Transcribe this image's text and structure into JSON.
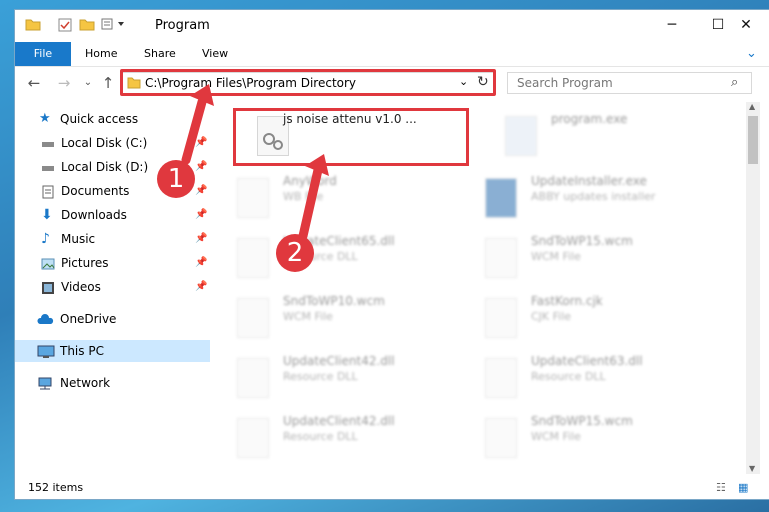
{
  "window": {
    "title": "Program"
  },
  "ribbon": {
    "tabs": [
      "File",
      "Home",
      "Share",
      "View"
    ]
  },
  "address": {
    "path": "C:\\Program Files\\Program Directory"
  },
  "search": {
    "placeholder": "Search Program"
  },
  "nav": {
    "items": [
      {
        "label": "Quick access",
        "icon": "star-icon"
      },
      {
        "label": "Local Disk (C:)",
        "icon": "drive-icon"
      },
      {
        "label": "Local Disk (D:)",
        "icon": "drive-icon"
      },
      {
        "label": "Documents",
        "icon": "documents-icon"
      },
      {
        "label": "Downloads",
        "icon": "download-icon"
      },
      {
        "label": "Music",
        "icon": "music-icon"
      },
      {
        "label": "Pictures",
        "icon": "pictures-icon"
      },
      {
        "label": "Videos",
        "icon": "videos-icon"
      },
      {
        "label": "OneDrive",
        "icon": "cloud-icon"
      },
      {
        "label": "This PC",
        "icon": "computer-icon"
      },
      {
        "label": "Network",
        "icon": "network-icon"
      }
    ]
  },
  "files": [
    {
      "name": "js noise attenu v1.0 ...",
      "type": ""
    },
    {
      "name": "program.exe",
      "type": ""
    },
    {
      "name": "AnyWord",
      "type": "WB File"
    },
    {
      "name": "UpdateInstaller.exe",
      "type": "ABBY updates installer"
    },
    {
      "name": "UpdateClient65.dll",
      "type": "Resource DLL"
    },
    {
      "name": "SndToWP15.wcm",
      "type": "WCM File"
    },
    {
      "name": "SndToWP10.wcm",
      "type": "WCM File"
    },
    {
      "name": "FastKorn.cjk",
      "type": "CJK File"
    },
    {
      "name": "UpdateClient42.dll",
      "type": "Resource DLL"
    },
    {
      "name": "UpdateClient63.dll",
      "type": "Resource DLL"
    },
    {
      "name": "UpdateClient42.dll",
      "type": "Resource DLL"
    },
    {
      "name": "SndToWP15.wcm",
      "type": "WCM File"
    }
  ],
  "status": {
    "count": "152 items"
  },
  "annotations": {
    "one": "1",
    "two": "2"
  },
  "colors": {
    "highlight": "#e0383e",
    "accent": "#1979ca"
  }
}
